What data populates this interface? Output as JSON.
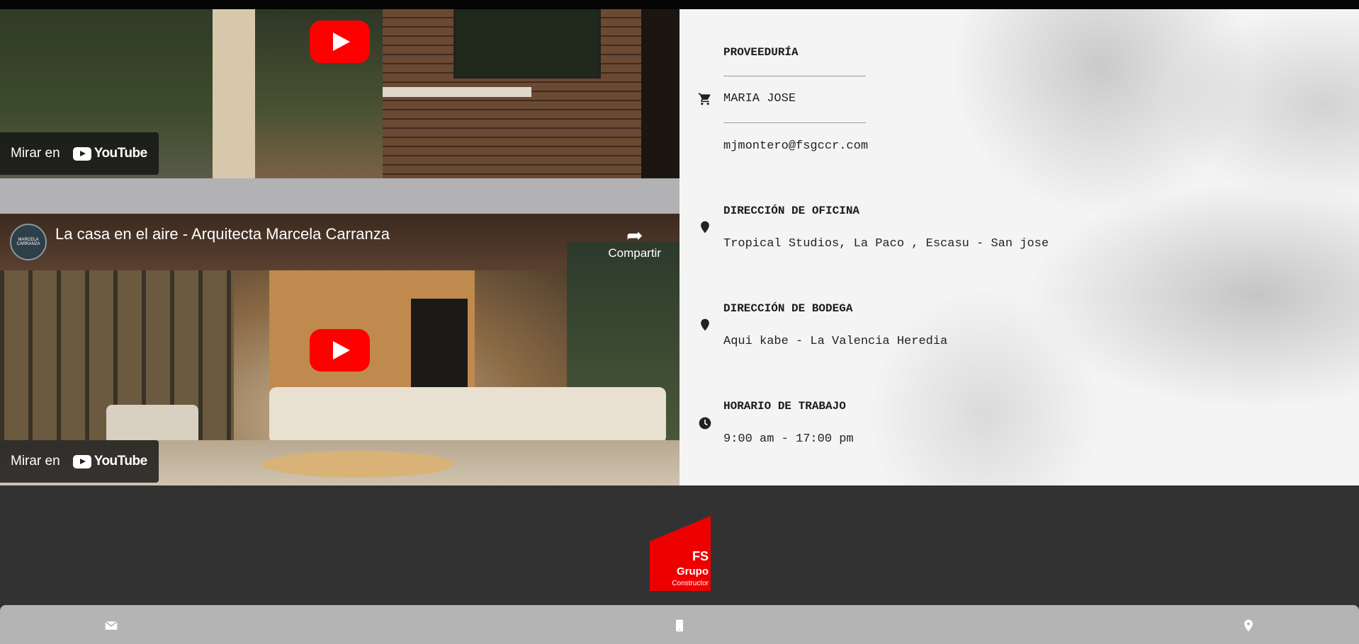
{
  "video1": {
    "watch_label": "Mirar en",
    "youtube_label": "YouTube"
  },
  "video2": {
    "title": "La casa en el aire - Arquitecta Marcela Carranza",
    "channel_avatar_text": "MARCELA CARRANZA",
    "share_label": "Compartir",
    "watch_label": "Mirar en",
    "youtube_label": "YouTube"
  },
  "contact": {
    "supplier_heading": "PROVEEDURÍA",
    "supplier_name": "MARIA JOSE",
    "supplier_email": "mjmontero@fsgccr.com",
    "office_heading": "DIRECCIÓN DE OFICINA",
    "office_address": "Tropical Studios, La Paco , Escasu - San jose",
    "warehouse_heading": "DIRECCIÓN DE BODEGA",
    "warehouse_address": "Aqui kabe - La Valencia Heredia",
    "hours_heading": "HORARIO DE TRABAJO",
    "hours_value": "9:00 am - 17:00 pm"
  },
  "footer_logo": {
    "line1": "FS",
    "line2": "Grupo",
    "line3": "Constructor"
  },
  "colors": {
    "brand_red": "#ee0000",
    "footer_bg": "#333233",
    "bottom_bar": "#b5b4b5"
  },
  "icons": [
    "cart-icon",
    "location-pin-icon",
    "clock-icon",
    "mail-icon",
    "phone-icon",
    "map-pin-icon"
  ]
}
